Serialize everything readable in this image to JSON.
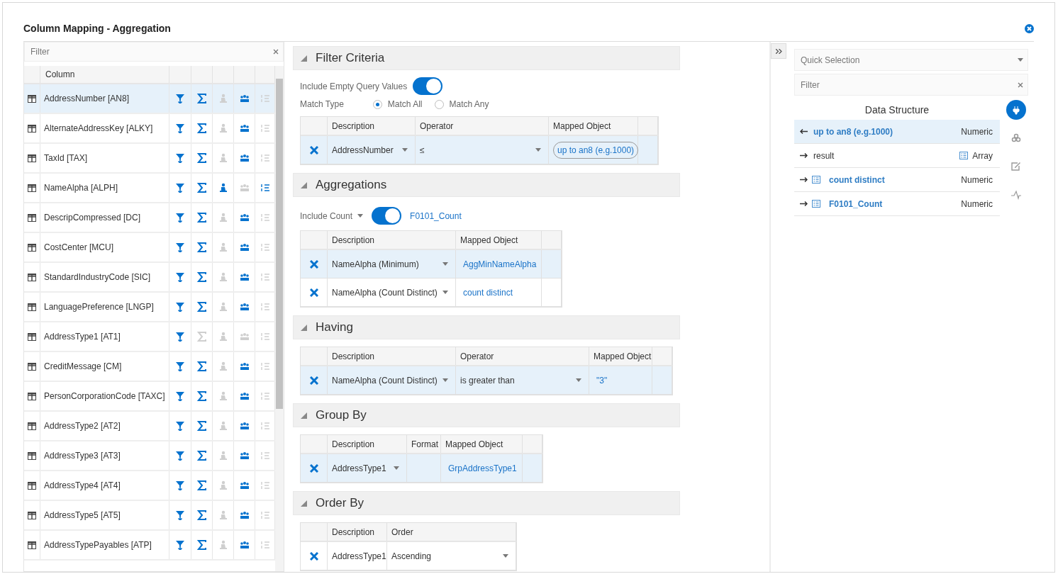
{
  "dialog": {
    "title": "Column Mapping - Aggregation"
  },
  "columns_panel": {
    "filter_placeholder": "Filter",
    "header": "Column",
    "rows": [
      {
        "name": "AddressNumber [AN8]",
        "selected": true,
        "actions": {
          "filter": true,
          "aggregate": true,
          "having": false,
          "group": true,
          "order": false
        }
      },
      {
        "name": "AlternateAddressKey [ALKY]",
        "selected": false,
        "actions": {
          "filter": true,
          "aggregate": true,
          "having": false,
          "group": true,
          "order": false
        }
      },
      {
        "name": "TaxId [TAX]",
        "selected": false,
        "actions": {
          "filter": true,
          "aggregate": true,
          "having": false,
          "group": true,
          "order": false
        }
      },
      {
        "name": "NameAlpha [ALPH]",
        "selected": false,
        "actions": {
          "filter": true,
          "aggregate": true,
          "having": true,
          "group": false,
          "order": true
        }
      },
      {
        "name": "DescripCompressed [DC]",
        "selected": false,
        "actions": {
          "filter": true,
          "aggregate": true,
          "having": false,
          "group": true,
          "order": false
        }
      },
      {
        "name": "CostCenter [MCU]",
        "selected": false,
        "actions": {
          "filter": true,
          "aggregate": true,
          "having": false,
          "group": true,
          "order": false
        }
      },
      {
        "name": "StandardIndustryCode [SIC]",
        "selected": false,
        "actions": {
          "filter": true,
          "aggregate": true,
          "having": false,
          "group": true,
          "order": false
        }
      },
      {
        "name": "LanguagePreference [LNGP]",
        "selected": false,
        "actions": {
          "filter": true,
          "aggregate": true,
          "having": false,
          "group": true,
          "order": false
        }
      },
      {
        "name": "AddressType1 [AT1]",
        "selected": false,
        "actions": {
          "filter": true,
          "aggregate": false,
          "having": false,
          "group": false,
          "order": false
        }
      },
      {
        "name": "CreditMessage [CM]",
        "selected": false,
        "actions": {
          "filter": true,
          "aggregate": true,
          "having": false,
          "group": true,
          "order": false
        }
      },
      {
        "name": "PersonCorporationCode [TAXC]",
        "selected": false,
        "actions": {
          "filter": true,
          "aggregate": true,
          "having": false,
          "group": true,
          "order": false
        }
      },
      {
        "name": "AddressType2 [AT2]",
        "selected": false,
        "actions": {
          "filter": true,
          "aggregate": true,
          "having": false,
          "group": true,
          "order": false
        }
      },
      {
        "name": "AddressType3 [AT3]",
        "selected": false,
        "actions": {
          "filter": true,
          "aggregate": true,
          "having": false,
          "group": true,
          "order": false
        }
      },
      {
        "name": "AddressType4 [AT4]",
        "selected": false,
        "actions": {
          "filter": true,
          "aggregate": true,
          "having": false,
          "group": true,
          "order": false
        }
      },
      {
        "name": "AddressType5 [AT5]",
        "selected": false,
        "actions": {
          "filter": true,
          "aggregate": true,
          "having": false,
          "group": true,
          "order": false
        }
      },
      {
        "name": "AddressTypePayables [ATP]",
        "selected": false,
        "actions": {
          "filter": true,
          "aggregate": true,
          "having": false,
          "group": true,
          "order": false
        }
      }
    ]
  },
  "sections": [
    {
      "title": "Filter Criteria",
      "expanded": true,
      "toggle": {
        "label": "Include Empty Query Values",
        "on": true
      },
      "match_type": {
        "label": "Match Type",
        "options": [
          {
            "label": "Match All",
            "selected": true
          },
          {
            "label": "Match Any",
            "selected": false
          }
        ]
      },
      "table": {
        "columns": [
          "Description",
          "Operator",
          "Mapped Object"
        ],
        "rows": [
          {
            "selected": true,
            "cells": [
              {
                "kind": "dropdown",
                "text": "AddressNumber"
              },
              {
                "kind": "dropdown",
                "text": "≤"
              },
              {
                "kind": "pill",
                "text": "up to an8 (e.g.1000)"
              }
            ]
          }
        ]
      }
    },
    {
      "title": "Aggregations",
      "expanded": true,
      "count_toggle": {
        "label": "Include Count",
        "on": true,
        "mapped": "F0101_Count"
      },
      "table": {
        "columns": [
          "Description",
          "Mapped Object"
        ],
        "rows": [
          {
            "selected": true,
            "cells": [
              {
                "kind": "dropdown",
                "text": "NameAlpha (Minimum)"
              },
              {
                "kind": "link",
                "text": "AggMinNameAlpha"
              }
            ]
          },
          {
            "selected": false,
            "cells": [
              {
                "kind": "dropdown",
                "text": "NameAlpha (Count Distinct)"
              },
              {
                "kind": "link",
                "text": "count distinct"
              }
            ]
          }
        ]
      }
    },
    {
      "title": "Having",
      "expanded": true,
      "table": {
        "columns": [
          "Description",
          "Operator",
          "Mapped Object"
        ],
        "rows": [
          {
            "selected": true,
            "cells": [
              {
                "kind": "dropdown",
                "text": "NameAlpha (Count Distinct)"
              },
              {
                "kind": "dropdown",
                "text": "is greater than"
              },
              {
                "kind": "link",
                "text": "\"3\""
              }
            ]
          }
        ]
      }
    },
    {
      "title": "Group By",
      "expanded": true,
      "table": {
        "columns": [
          "Description",
          "Format",
          "Mapped Object"
        ],
        "rows": [
          {
            "selected": true,
            "cells": [
              {
                "kind": "dropdown",
                "text": "AddressType1"
              },
              null,
              {
                "kind": "link",
                "text": "GrpAddressType1"
              }
            ]
          }
        ]
      }
    },
    {
      "title": "Order By",
      "expanded": true,
      "table": {
        "columns": [
          "Description",
          "Order"
        ],
        "rows": [
          {
            "selected": false,
            "cells": [
              {
                "kind": "text",
                "text": "AddressType1"
              },
              {
                "kind": "dropdown",
                "text": "Ascending"
              }
            ]
          }
        ]
      }
    }
  ],
  "data_panel": {
    "quick_selection_placeholder": "Quick Selection",
    "filter_placeholder": "Filter",
    "title": "Data Structure",
    "items": [
      {
        "kind": "input",
        "name": "up to an8 (e.g.1000)",
        "emphasis": true,
        "type": "Numeric",
        "selected": true
      },
      {
        "kind": "output",
        "name": "result",
        "emphasis": false,
        "type_list_icon": true,
        "type": "Array",
        "selected": false
      },
      {
        "kind": "output",
        "name": "count distinct",
        "emphasis": true,
        "name_list_icon": true,
        "type": "Numeric",
        "selected": false
      },
      {
        "kind": "output",
        "name": "F0101_Count",
        "emphasis": true,
        "name_list_icon": true,
        "type": "Numeric",
        "selected": false
      }
    ],
    "tools": [
      {
        "kind": "plug",
        "selected": true
      },
      {
        "kind": "cubes",
        "selected": false
      },
      {
        "kind": "edit",
        "selected": false
      },
      {
        "kind": "signal",
        "selected": false
      }
    ]
  }
}
